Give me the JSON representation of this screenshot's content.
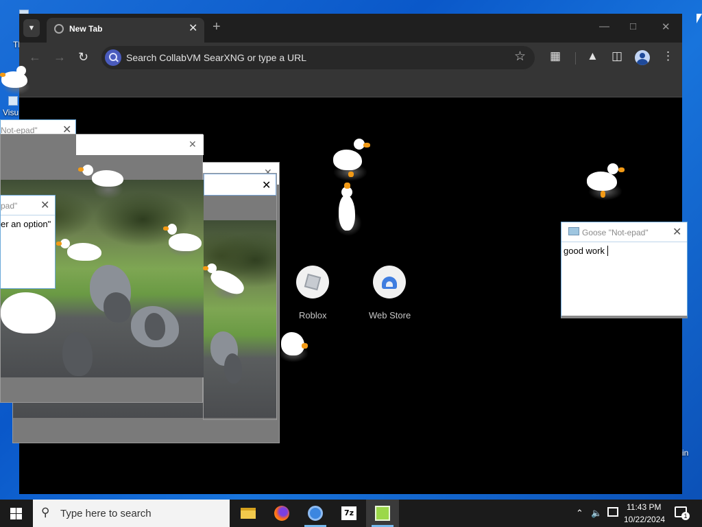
{
  "desktop": {
    "icons": [
      {
        "label": "Th",
        "icon": "recycle-bin-icon"
      },
      {
        "label": "Visu",
        "icon": "vscode-shortcut-icon"
      },
      {
        "label": "in",
        "icon": "shortcut-icon"
      }
    ]
  },
  "browser": {
    "tab": {
      "title": "New Tab",
      "icon": "globe-icon"
    },
    "omnibox": {
      "placeholder": "Search CollabVM SearXNG or type a URL"
    },
    "toolbar_icons": [
      "back-icon",
      "forward-icon",
      "reload-icon",
      "star-icon",
      "extensions-icon",
      "labs-icon",
      "side-panel-icon",
      "profile-icon",
      "menu-icon"
    ],
    "shortcuts": [
      {
        "label": "Roblox",
        "icon": "roblox-icon"
      },
      {
        "label": "Web Store",
        "icon": "web-store-icon"
      }
    ]
  },
  "notepads": [
    {
      "title": "Goose \"Not-epad\"",
      "text": "good work"
    },
    {
      "title": "Not-epad\"",
      "text": ""
    },
    {
      "title": "pad\"",
      "text": "er an option\""
    }
  ],
  "taskbar": {
    "search_placeholder": "Type here to search",
    "apps": [
      "file-explorer-icon",
      "firefox-icon",
      "chromium-icon",
      "7zip-icon",
      "notepad-icon"
    ],
    "clock": {
      "time": "11:43 PM",
      "date": "10/22/2024"
    },
    "notification_count": "1"
  },
  "colors": {
    "desktop_bg": "#0a58c9",
    "browser_chrome": "#353535",
    "taskbar": "#1b1b1b",
    "accent": "#76b9ed",
    "goose_beak": "#f29a16"
  }
}
